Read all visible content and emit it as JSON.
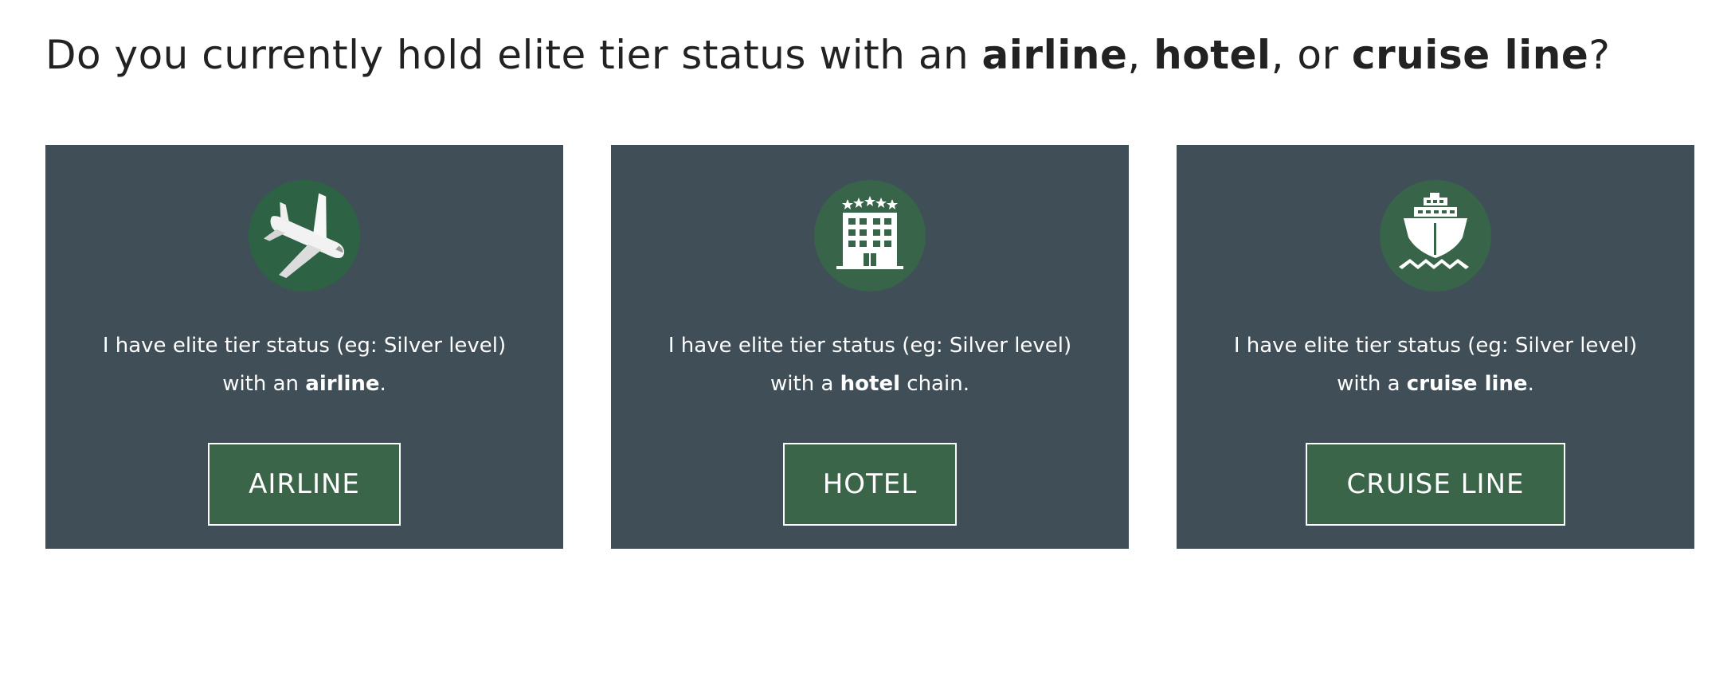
{
  "question": {
    "prefix": "Do you currently hold elite tier status with an ",
    "airline": "airline",
    "sep1": ", ",
    "hotel": "hotel",
    "sep2": ", or ",
    "cruise": "cruise line",
    "suffix": "?"
  },
  "colors": {
    "card_background": "#3f4e57",
    "icon_circle": "#2e6244",
    "button_background": "#3b6549",
    "button_border": "#ffffff"
  },
  "cards": [
    {
      "icon": "airplane-icon",
      "desc_line1": "I have elite tier status (eg: Silver level)",
      "desc_pre": "with an ",
      "desc_bold": "airline",
      "desc_post": ".",
      "button_label": "AIRLINE"
    },
    {
      "icon": "hotel-building-icon",
      "desc_line1": "I have elite tier status (eg: Silver level)",
      "desc_pre": "with a ",
      "desc_bold": "hotel",
      "desc_post": " chain.",
      "button_label": "HOTEL"
    },
    {
      "icon": "cruise-ship-icon",
      "desc_line1": "I have elite tier status (eg: Silver level)",
      "desc_pre": "with a ",
      "desc_bold": "cruise line",
      "desc_post": ".",
      "button_label": "CRUISE LINE"
    }
  ]
}
